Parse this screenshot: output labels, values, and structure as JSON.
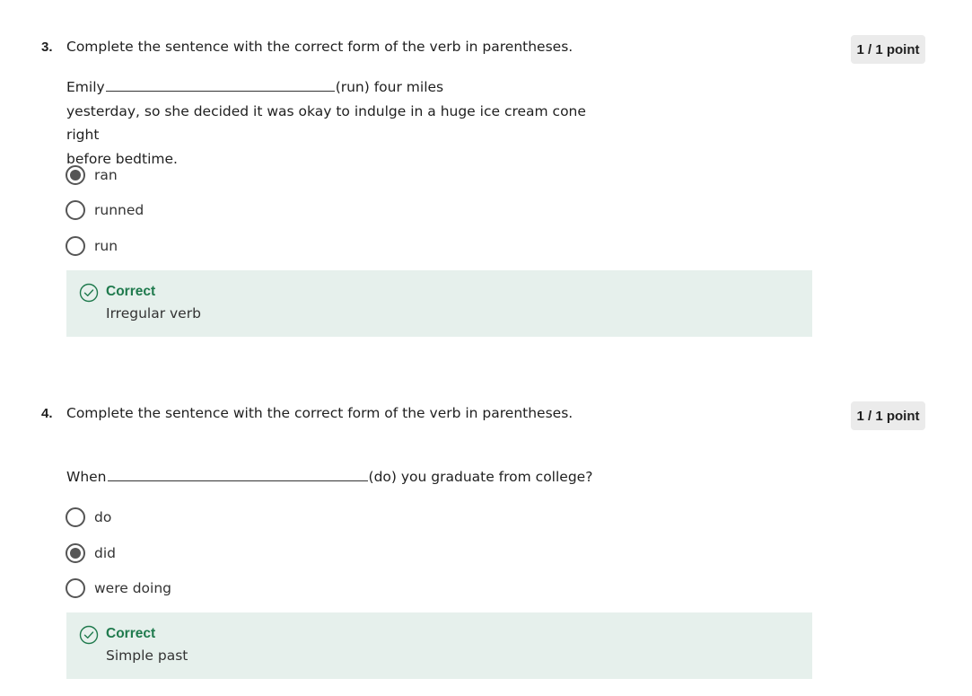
{
  "colors": {
    "correct": "#1f7a4d",
    "feedback_bg": "#e6f0ec",
    "badge_bg": "#ebebeb"
  },
  "questions": [
    {
      "number": "3.",
      "prompt": "Complete the sentence with the correct form of the verb in parentheses.",
      "points": "1 / 1 point",
      "sentence_before": "Emily",
      "sentence_after": "(run) four miles",
      "sentence_line2": "yesterday, so she decided it was okay to indulge in a huge ice cream cone right",
      "sentence_line3": "before bedtime.",
      "options": [
        {
          "label": "ran",
          "selected": true
        },
        {
          "label": "runned",
          "selected": false
        },
        {
          "label": "run",
          "selected": false
        }
      ],
      "feedback": {
        "status": "Correct",
        "explanation": "Irregular verb",
        "icon": "check-circle-icon"
      }
    },
    {
      "number": "4.",
      "prompt": "Complete the sentence with the correct form of the verb in parentheses.",
      "points": "1 / 1 point",
      "sentence_before": "When",
      "sentence_after": "(do) you graduate from college?",
      "options": [
        {
          "label": "do",
          "selected": false
        },
        {
          "label": "did",
          "selected": true
        },
        {
          "label": "were doing",
          "selected": false
        }
      ],
      "feedback": {
        "status": "Correct",
        "explanation": "Simple past",
        "icon": "check-circle-icon"
      }
    }
  ]
}
